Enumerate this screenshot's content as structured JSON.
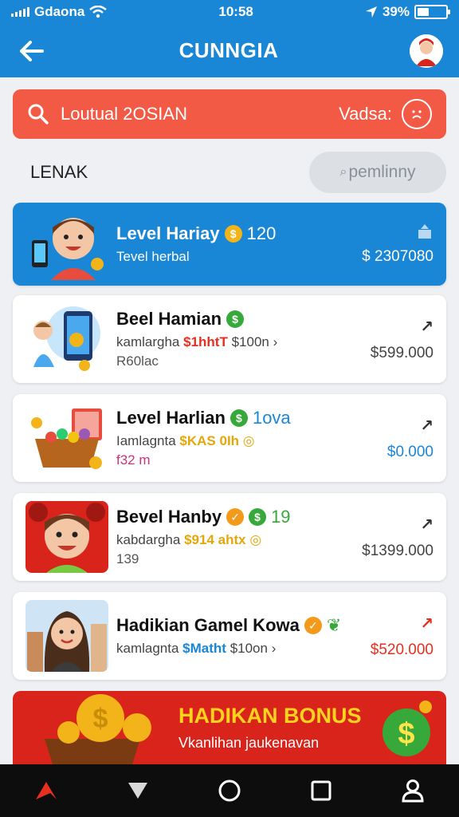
{
  "status": {
    "carrier": "Gdaona",
    "time": "10:58",
    "battery": "39%"
  },
  "header": {
    "title": "CUNNGIA"
  },
  "search": {
    "text": "Loutual 2OSIAN",
    "right_label": "Vadsa:"
  },
  "section": {
    "title": "LENAK",
    "filter": "pemlinny"
  },
  "featured": {
    "title": "Level Hariay",
    "coin_value": "120",
    "subtitle": "Tevel herbal",
    "price": "$ 2307080"
  },
  "items": [
    {
      "title": "Beel Hamian",
      "sub_prefix": "kamlargha",
      "sub_hl": "$1hhtT",
      "sub_suffix": "$100n",
      "meta": "R60lac",
      "price": "$599.000"
    },
    {
      "title": "Level Harlian",
      "title_extra": "1ova",
      "sub_prefix": "Iamlagnta",
      "sub_hl": "$KAS",
      "sub_suffix": "0Ih",
      "meta": "f32 m",
      "price": "$0.000"
    },
    {
      "title": "Bevel Hanby",
      "title_extra": "19",
      "sub_prefix": "kabdargha",
      "sub_hl": "$914",
      "sub_suffix": "ahtx",
      "meta": "139",
      "price": "$1399.000"
    },
    {
      "title": "Hadikian Gamel Kowa",
      "sub_prefix": "kamlagnta",
      "sub_hl": "$Matht",
      "sub_suffix": "$10on",
      "meta": "",
      "price": "$520.000"
    }
  ],
  "bonus": {
    "title": "HADIKAN BONUS",
    "subtitle": "Vkanlihan jaukenavan"
  },
  "colors": {
    "primary": "#1a86d6",
    "accent_red": "#f25a45",
    "bonus_red": "#d9241c",
    "coin": "#f2b418"
  }
}
